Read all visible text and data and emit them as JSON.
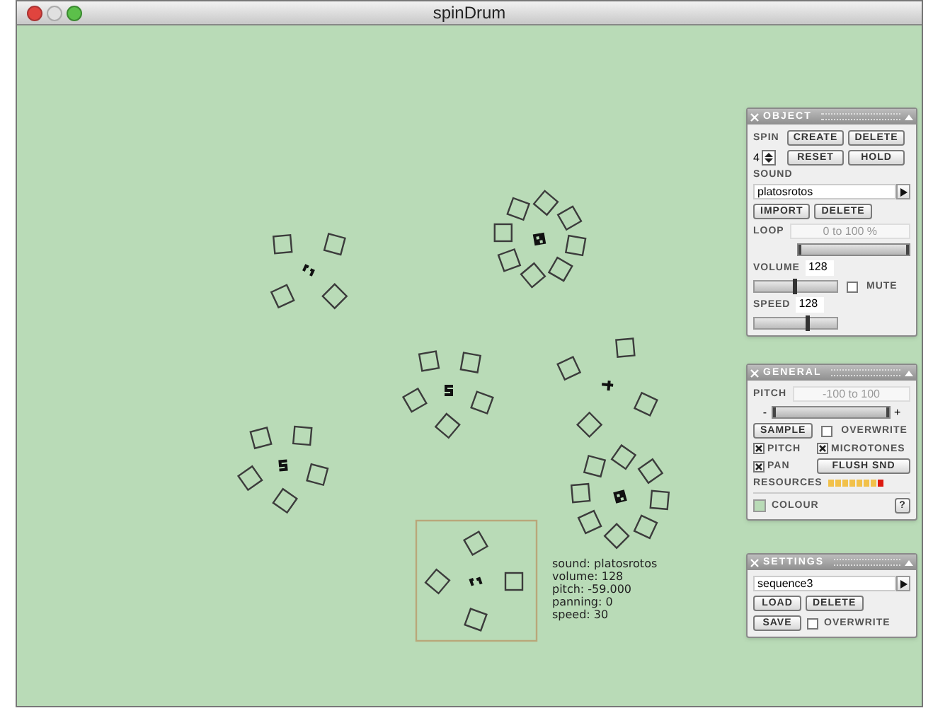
{
  "window": {
    "title": "spinDrum"
  },
  "spinners": [
    {
      "selected": false
    },
    {
      "selected": false
    },
    {
      "selected": false
    },
    {
      "selected": false
    },
    {
      "selected": false
    },
    {
      "selected": false
    },
    {
      "selected": true
    }
  ],
  "info": [
    "sound: platosrotos",
    "volume: 128",
    "pitch: -59.000",
    "panning: 0",
    "speed: 30"
  ],
  "object_panel": {
    "title": "OBJECT",
    "spin_label": "SPIN",
    "create": "CREATE",
    "delete": "DELETE",
    "spin_count": "4",
    "reset": "RESET",
    "hold": "HOLD",
    "sound_label": "SOUND",
    "sound": "platosrotos",
    "import": "IMPORT",
    "delete_sound": "DELETE",
    "loop_label": "LOOP",
    "loop_range": "0 to 100 %",
    "loop_slider": {
      "level": 1
    },
    "volume_label": "VOLUME",
    "volume": "128",
    "volume_slider": {
      "level": 0.5
    },
    "mute": {
      "label": "MUTE",
      "checked": false
    },
    "speed_label": "SPEED",
    "speed": "128",
    "speed_slider": {
      "level": 0.65
    }
  },
  "general_panel": {
    "title": "GENERAL",
    "pitch_label": "PITCH",
    "pitch_range": "-100 to 100",
    "pitch_slider": {
      "level": 1
    },
    "minus": "-",
    "plus": "+",
    "sample": "SAMPLE",
    "overwrite": {
      "label": "OVERWRITE",
      "checked": false
    },
    "options": [
      {
        "label": "PITCH",
        "checked": true
      },
      {
        "label": "MICROTONES",
        "checked": true
      },
      {
        "label": "PAN",
        "checked": true
      }
    ],
    "flush": "FLUSH SND",
    "resources": {
      "label": "RESOURCES"
    },
    "colour": {
      "label": "COLOUR",
      "color": "#b9dbb7"
    },
    "help": "?"
  },
  "settings_panel": {
    "title": "SETTINGS",
    "sequence": "sequence3",
    "load": "LOAD",
    "delete": "DELETE",
    "save": "SAVE",
    "overwrite": {
      "label": "OVERWRITE",
      "checked": false
    }
  }
}
